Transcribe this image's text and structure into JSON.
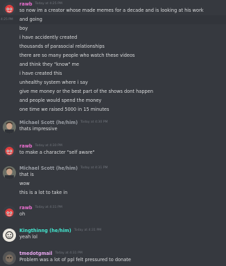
{
  "messages": [
    {
      "author": "rawb",
      "timestamp": "Today at 4:25 PM",
      "lines": [
        "so now im a creator whose made memes for a decade and is looking at his work",
        "and going",
        "boy",
        "i have accidently created",
        "thousands of parasocial relationships",
        "there are so many people who watch these videos",
        "and think they \"know\" me",
        "i have created this",
        "unhealthy system where i say",
        "give me money or the best part of the shows dont happen",
        "and people would spend the money",
        "one time we raised 5000 in 15 minutes"
      ],
      "hover_timestamp": "4:25 PM"
    },
    {
      "author": "Michael Scott (he/him)",
      "timestamp": "Today at 4:30 PM",
      "lines": [
        "thats impressive"
      ]
    },
    {
      "author": "rawb",
      "timestamp": "Today at 4:30 PM",
      "lines": [
        "to make a character \"self aware\""
      ]
    },
    {
      "author": "Michael Scott (he/him)",
      "timestamp": "Today at 4:31 PM",
      "lines": [
        "that is",
        "wow",
        "this is a lot to take in"
      ]
    },
    {
      "author": "rawb",
      "timestamp": "Today at 4:31 PM",
      "lines": [
        "oh"
      ]
    },
    {
      "author": "Kingthinng (he/him)",
      "timestamp": "Today at 4:31 PM",
      "lines": [
        "yeah lol"
      ]
    },
    {
      "author": "tmedotgmail",
      "timestamp": "Today at 4:31 PM",
      "lines": [
        "Problem was a lot of ppl felt pressured to donate"
      ]
    }
  ],
  "colors": {
    "background": "#36393f",
    "rawb": "#eb6fd0",
    "michael": "#9a9ea5",
    "king": "#43e8d0",
    "tmed": "#e9a7f0",
    "text": "#dcddde",
    "timestamp": "#72767d"
  }
}
